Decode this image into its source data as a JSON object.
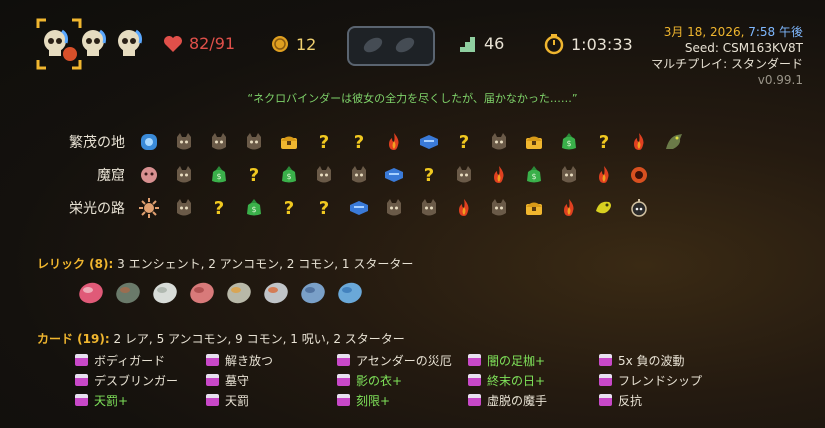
{
  "header": {
    "hp": "82/91",
    "gold": "12",
    "floor": "46",
    "time": "1:03:33",
    "date_prefix": "3月 18, 2026,",
    "date_time": "7:58 午後",
    "seed": "Seed: CSM163KV8T",
    "mode": "マルチプレイ: スタンダード",
    "version": "v0.99.1"
  },
  "quote": "“ネクロバインダーは彼女の全力を尽くしたが、届かなかった……”",
  "acts": [
    {
      "name": "繁茂の地",
      "nodes": [
        "ancient-blue",
        "monster",
        "monster",
        "monster",
        "chest",
        "unknown",
        "unknown",
        "elite",
        "shop",
        "unknown",
        "monster",
        "chest",
        "merchant",
        "unknown",
        "elite",
        "boss-vine"
      ]
    },
    {
      "name": "魔窟",
      "nodes": [
        "ancient-pink",
        "monster",
        "merchant",
        "unknown",
        "merchant",
        "monster",
        "monster",
        "shop",
        "unknown",
        "monster",
        "elite",
        "merchant",
        "monster",
        "elite",
        "boss-orb"
      ]
    },
    {
      "name": "栄光の路",
      "nodes": [
        "ancient-sun",
        "monster",
        "unknown",
        "merchant",
        "unknown",
        "unknown",
        "shop",
        "monster",
        "monster",
        "elite",
        "monster",
        "chest",
        "elite",
        "boss-bird",
        "boss-bomb"
      ]
    }
  ],
  "relics": {
    "label": "レリック (8):",
    "summary": "3 エンシェント, 2 アンコモン, 2 コモン, 1 スターター",
    "items": [
      "heart-relic",
      "stone-relic",
      "pearl-relic",
      "flesh-relic",
      "crystal-relic",
      "cleaver-relic",
      "scroll-relic",
      "feather-relic"
    ]
  },
  "cards": {
    "label": "カード (19):",
    "summary": "2 レア, 5 アンコモン, 9 コモン, 1 呪い, 2 スターター",
    "columns": [
      [
        {
          "name": "ボディガード",
          "upgraded": false
        },
        {
          "name": "デスブリンガー",
          "upgraded": false
        },
        {
          "name": "天罰+",
          "upgraded": true
        }
      ],
      [
        {
          "name": "解き放つ",
          "upgraded": false
        },
        {
          "name": "墓守",
          "upgraded": false
        },
        {
          "name": "天罰",
          "upgraded": false
        }
      ],
      [
        {
          "name": "アセンダーの災厄",
          "upgraded": false
        },
        {
          "name": "影の衣+",
          "upgraded": true
        },
        {
          "name": "刻限+",
          "upgraded": true
        }
      ],
      [
        {
          "name": "闇の足枷+",
          "upgraded": true
        },
        {
          "name": "終末の日+",
          "upgraded": true
        },
        {
          "name": "虚脱の魔手",
          "upgraded": false
        }
      ],
      [
        {
          "name": "5x 負の波動",
          "upgraded": false
        },
        {
          "name": "フレンドシップ",
          "upgraded": false
        },
        {
          "name": "反抗",
          "upgraded": false
        }
      ]
    ]
  },
  "colors": {
    "accent": "#f0b62f",
    "upgraded": "#7fe35a",
    "quote": "#7fd36a",
    "hp": "#e0504a"
  }
}
